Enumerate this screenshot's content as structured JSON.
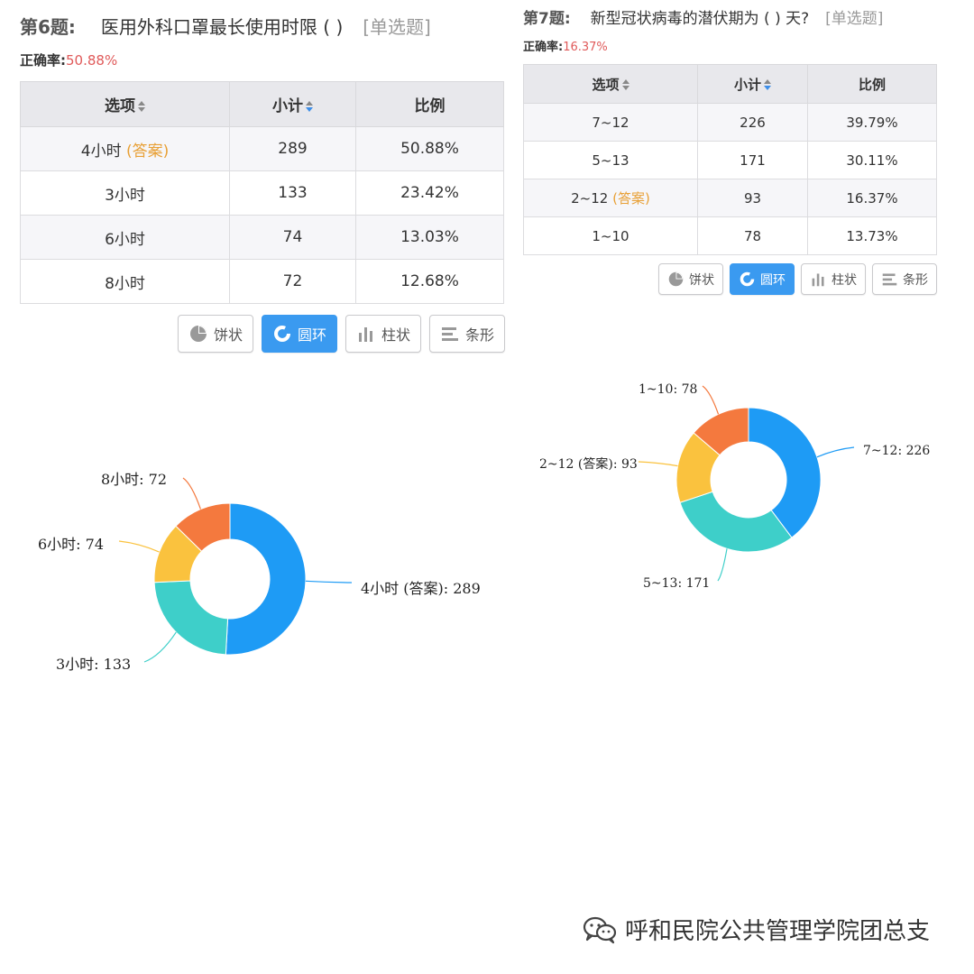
{
  "q6": {
    "num": "第6题:",
    "title": "医用外科口罩最长使用时限 ( )",
    "type": "[单选题]",
    "rate_label": "正确率:",
    "rate_value": "50.88%",
    "columns": [
      "选项",
      "小计",
      "比例"
    ],
    "rows": [
      {
        "option": "4小时",
        "ans": "(答案)",
        "count": "289",
        "pct": "50.88%"
      },
      {
        "option": "3小时",
        "ans": "",
        "count": "133",
        "pct": "23.42%"
      },
      {
        "option": "6小时",
        "ans": "",
        "count": "74",
        "pct": "13.03%"
      },
      {
        "option": "8小时",
        "ans": "",
        "count": "72",
        "pct": "12.68%"
      }
    ],
    "buttons": [
      "饼状",
      "圆环",
      "柱状",
      "条形"
    ],
    "active_button": "圆环"
  },
  "q7": {
    "num": "第7题:",
    "title": "新型冠状病毒的潜伏期为 ( ) 天?",
    "type": "[单选题]",
    "rate_label": "正确率:",
    "rate_value": "16.37%",
    "columns": [
      "选项",
      "小计",
      "比例"
    ],
    "rows": [
      {
        "option": "7~12",
        "ans": "",
        "count": "226",
        "pct": "39.79%"
      },
      {
        "option": "5~13",
        "ans": "",
        "count": "171",
        "pct": "30.11%"
      },
      {
        "option": "2~12",
        "ans": "(答案)",
        "count": "93",
        "pct": "16.37%"
      },
      {
        "option": "1~10",
        "ans": "",
        "count": "78",
        "pct": "13.73%"
      }
    ],
    "buttons": [
      "饼状",
      "圆环",
      "柱状",
      "条形"
    ],
    "active_button": "圆环"
  },
  "colors": {
    "blue": "#1e9bf5",
    "cyan": "#3ecfc9",
    "yellow": "#fac23e",
    "orange": "#f4793e",
    "active_button": "#3a9af0",
    "answer": "#e8a036",
    "rate": "#e05a5a"
  },
  "icons": [
    "pie-icon",
    "ring-icon",
    "bar-icon",
    "hbar-icon",
    "wechat-icon"
  ],
  "chart_data": [
    {
      "type": "donut",
      "categories": [
        "4小时 (答案)",
        "3小时",
        "6小时",
        "8小时"
      ],
      "values": [
        289,
        133,
        74,
        72
      ],
      "labels": [
        "4小时 (答案): 289",
        "3小时: 133",
        "6小时: 74",
        "8小时: 72"
      ]
    },
    {
      "type": "donut",
      "categories": [
        "7~12",
        "5~13",
        "2~12 (答案)",
        "1~10"
      ],
      "values": [
        226,
        171,
        93,
        78
      ],
      "labels": [
        "7~12: 226",
        "5~13: 171",
        "2~12 (答案): 93",
        "1~10: 78"
      ]
    }
  ],
  "footer": {
    "text": "呼和民院公共管理学院团总支"
  }
}
